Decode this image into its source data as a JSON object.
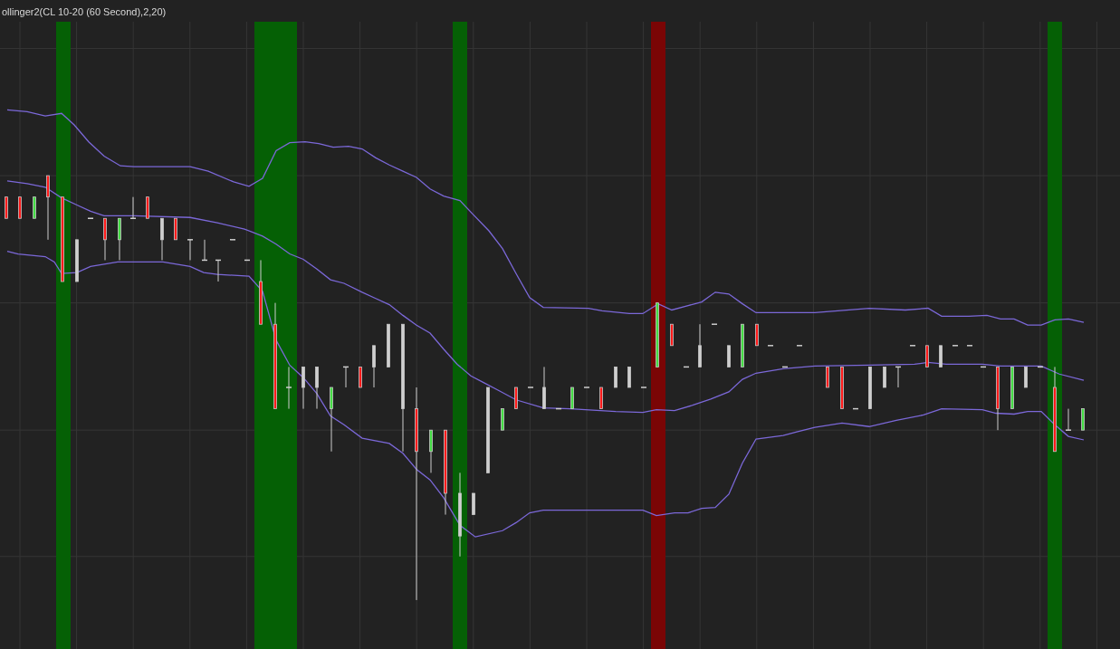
{
  "chart": {
    "title": "ollinger2(CL 10-20 (60 Second),2,20)"
  }
}
